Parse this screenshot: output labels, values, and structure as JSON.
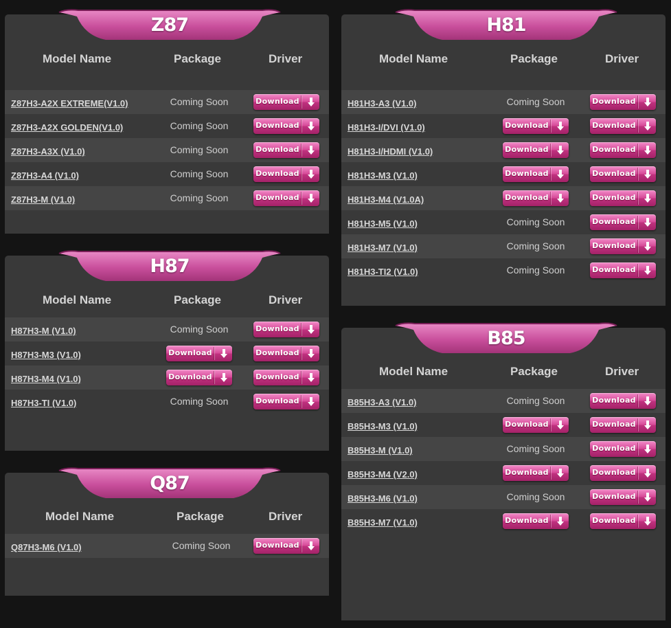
{
  "headers": {
    "model": "Model Name",
    "package": "Package",
    "driver": "Driver"
  },
  "coming_soon": "Coming Soon",
  "download_label": "Download",
  "colors": {
    "page_bg": "#141414",
    "panel_bg": "#393939",
    "row_alt": "#454545",
    "accent": "#d64a98"
  },
  "icons": {
    "download_arrow": "download-arrow-icon"
  },
  "panels": [
    {
      "title": "Z87",
      "models": [
        {
          "name": "Z87H3-A2X EXTREME(V1.0)",
          "package": "Coming Soon"
        },
        {
          "name": "Z87H3-A2X GOLDEN(V1.0)",
          "package": "Coming Soon"
        },
        {
          "name": "Z87H3-A3X (V1.0)",
          "package": "Coming Soon"
        },
        {
          "name": "Z87H3-A4 (V1.0)",
          "package": "Coming Soon"
        },
        {
          "name": "Z87H3-M (V1.0)",
          "package": "Coming Soon"
        }
      ]
    },
    {
      "title": "H87",
      "models": [
        {
          "name": "H87H3-M (V1.0)",
          "package": "Coming Soon"
        },
        {
          "name": "H87H3-M3 (V1.0)",
          "package": "Download"
        },
        {
          "name": "H87H3-M4 (V1.0)",
          "package": "Download"
        },
        {
          "name": "H87H3-TI (V1.0)",
          "package": "Coming Soon"
        }
      ]
    },
    {
      "title": "Q87",
      "models": [
        {
          "name": "Q87H3-M6 (V1.0)",
          "package": "Coming Soon"
        }
      ]
    },
    {
      "title": "H81",
      "models": [
        {
          "name": "H81H3-A3 (V1.0)",
          "package": "Coming Soon"
        },
        {
          "name": "H81H3-I/DVI (V1.0)",
          "package": "Download"
        },
        {
          "name": "H81H3-I/HDMI (V1.0)",
          "package": "Download"
        },
        {
          "name": "H81H3-M3 (V1.0)",
          "package": "Download"
        },
        {
          "name": "H81H3-M4 (V1.0A)",
          "package": "Download"
        },
        {
          "name": "H81H3-M5 (V1.0)",
          "package": "Coming Soon"
        },
        {
          "name": "H81H3-M7 (V1.0)",
          "package": "Coming Soon"
        },
        {
          "name": "H81H3-TI2 (V1.0)",
          "package": "Coming Soon"
        }
      ]
    },
    {
      "title": "B85",
      "models": [
        {
          "name": "B85H3-A3 (V1.0)",
          "package": "Coming Soon"
        },
        {
          "name": "B85H3-M3 (V1.0)",
          "package": "Download"
        },
        {
          "name": "B85H3-M (V1.0)",
          "package": "Coming Soon"
        },
        {
          "name": "B85H3-M4 (V2.0)",
          "package": "Download"
        },
        {
          "name": "B85H3-M6 (V1.0)",
          "package": "Coming Soon"
        },
        {
          "name": "B85H3-M7 (V1.0)",
          "package": "Download"
        }
      ]
    }
  ]
}
